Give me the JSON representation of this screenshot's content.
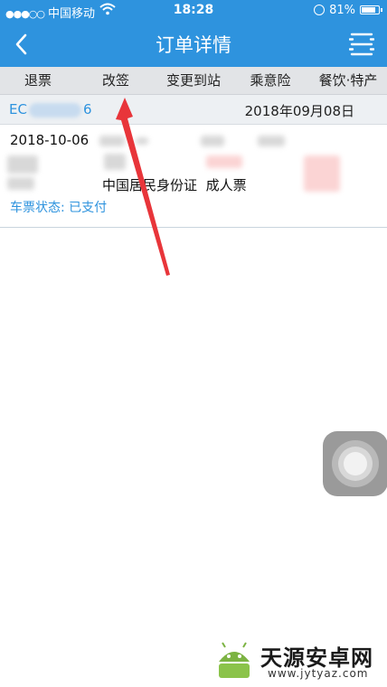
{
  "status_bar": {
    "signal": "●●●○○",
    "carrier": "中国移动",
    "time": "18:28",
    "battery": "81%"
  },
  "nav": {
    "title": "订单详情"
  },
  "tabs": [
    "退票",
    "改签",
    "变更到站",
    "乘意险",
    "餐饮·特产"
  ],
  "order": {
    "id_prefix": "EC",
    "id_suffix": "6",
    "date": "2018年09月08日"
  },
  "ticket": {
    "depart_date": "2018-10-06",
    "id_type": "中国居民身份证",
    "ticket_type": "成人票",
    "status_label": "车票状态:",
    "status_value": "已支付"
  },
  "watermark": {
    "name": "天源安卓网",
    "url": "www.jytyaz.com"
  },
  "colors": {
    "primary": "#2e93de",
    "arrow": "#e8353a"
  }
}
